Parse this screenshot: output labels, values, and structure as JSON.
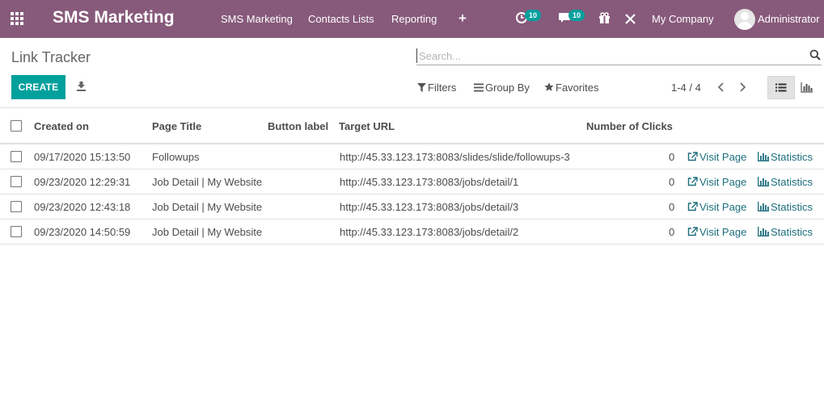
{
  "navbar": {
    "brand": "SMS Marketing",
    "menu": [
      "SMS Marketing",
      "Contacts Lists",
      "Reporting"
    ],
    "activity_badge": "10",
    "messages_badge": "10",
    "company": "My Company",
    "user": "Administrator"
  },
  "control": {
    "breadcrumb": "Link Tracker",
    "search_placeholder": "Search...",
    "create_label": "CREATE",
    "filters_label": "Filters",
    "groupby_label": "Group By",
    "favorites_label": "Favorites",
    "pager": "1-4 / 4"
  },
  "table": {
    "headers": {
      "created_on": "Created on",
      "page_title": "Page Title",
      "button_label": "Button label",
      "target_url": "Target URL",
      "clicks": "Number of Clicks"
    },
    "rows": [
      {
        "created_on": "09/17/2020 15:13:50",
        "page_title": "Followups",
        "button_label": "",
        "target_url": "http://45.33.123.173:8083/slides/slide/followups-3",
        "clicks": "0",
        "visit": "Visit Page",
        "stats": "Statistics"
      },
      {
        "created_on": "09/23/2020 12:29:31",
        "page_title": "Job Detail | My Website",
        "button_label": "",
        "target_url": "http://45.33.123.173:8083/jobs/detail/1",
        "clicks": "0",
        "visit": "Visit Page",
        "stats": "Statistics"
      },
      {
        "created_on": "09/23/2020 12:43:18",
        "page_title": "Job Detail | My Website",
        "button_label": "",
        "target_url": "http://45.33.123.173:8083/jobs/detail/3",
        "clicks": "0",
        "visit": "Visit Page",
        "stats": "Statistics"
      },
      {
        "created_on": "09/23/2020 14:50:59",
        "page_title": "Job Detail | My Website",
        "button_label": "",
        "target_url": "http://45.33.123.173:8083/jobs/detail/2",
        "clicks": "0",
        "visit": "Visit Page",
        "stats": "Statistics"
      }
    ]
  },
  "colors": {
    "navbar": "#875a7b",
    "primary": "#00a09d",
    "link": "#1c6e7c"
  },
  "icons": [
    "apps-grid-icon",
    "plus-icon",
    "activity-clock-icon",
    "chat-icon",
    "gift-icon",
    "tools-icon",
    "search-icon",
    "download-icon",
    "filter-icon",
    "group-by-icon",
    "star-icon",
    "chevron-left-icon",
    "chevron-right-icon",
    "list-view-icon",
    "graph-view-icon",
    "external-link-icon",
    "bar-chart-icon"
  ]
}
